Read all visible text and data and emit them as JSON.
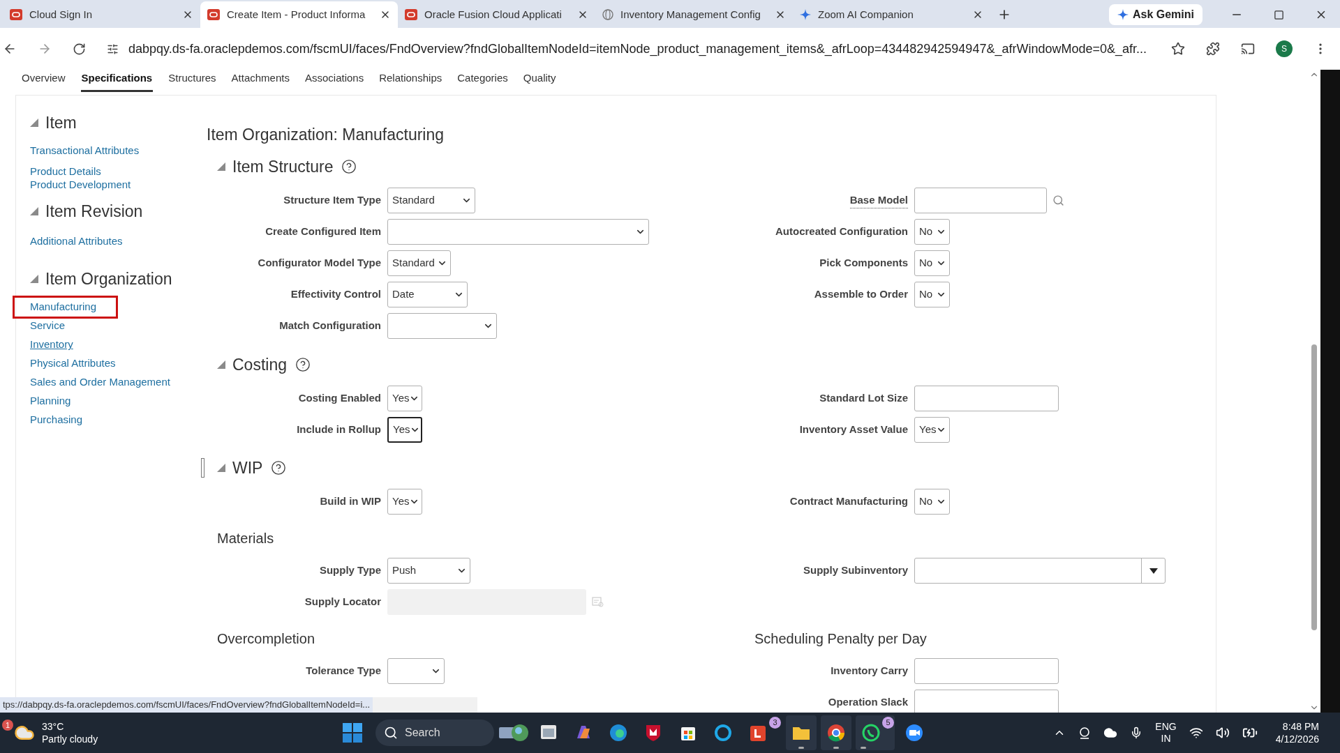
{
  "browser": {
    "tabs": [
      {
        "title": "Cloud Sign In",
        "selected": false
      },
      {
        "title": "Create Item - Product Informa",
        "selected": true
      },
      {
        "title": "Oracle Fusion Cloud Applicati",
        "selected": false
      },
      {
        "title": "Inventory Management Config",
        "selected": false
      },
      {
        "title": "Zoom AI Companion",
        "selected": false
      }
    ],
    "gemini_button": "Ask Gemini",
    "url": "dabpqy.ds-fa.oraclepdemos.com/fscmUI/faces/FndOverview?fndGlobalItemNodeId=itemNode_product_management_items&_afrLoop=434482942594947&_afrWindowMode=0&_afr...",
    "avatar": "S"
  },
  "page_tabs": [
    {
      "label": "Overview",
      "selected": false
    },
    {
      "label": "Specifications",
      "selected": true
    },
    {
      "label": "Structures",
      "selected": false
    },
    {
      "label": "Attachments",
      "selected": false
    },
    {
      "label": "Associations",
      "selected": false
    },
    {
      "label": "Relationships",
      "selected": false
    },
    {
      "label": "Categories",
      "selected": false
    },
    {
      "label": "Quality",
      "selected": false
    }
  ],
  "sidebar": {
    "groups": [
      {
        "title": "Item",
        "links": [
          {
            "label": "Transactional Attributes",
            "selected": false,
            "hovered": false
          },
          {
            "label": "Product Details",
            "selected": false,
            "hovered": false
          },
          {
            "label": "Product Development",
            "selected": false,
            "hovered": false
          }
        ]
      },
      {
        "title": "Item Revision",
        "links": [
          {
            "label": "Additional Attributes",
            "selected": false,
            "hovered": false
          }
        ]
      },
      {
        "title": "Item Organization",
        "links": [
          {
            "label": "Manufacturing",
            "selected": true,
            "hovered": false
          },
          {
            "label": "Service",
            "selected": false,
            "hovered": false
          },
          {
            "label": "Inventory",
            "selected": false,
            "hovered": true
          },
          {
            "label": "Physical Attributes",
            "selected": false,
            "hovered": false
          },
          {
            "label": "Sales and Order Management",
            "selected": false,
            "hovered": false
          },
          {
            "label": "Planning",
            "selected": false,
            "hovered": false
          },
          {
            "label": "Purchasing",
            "selected": false,
            "hovered": false
          }
        ]
      }
    ]
  },
  "main": {
    "title": "Item Organization: Manufacturing",
    "blocks": [
      {
        "kind": "section",
        "title": "Item Structure"
      },
      {
        "kind": "row",
        "left": {
          "label": "Structure Item Type",
          "kind": "select",
          "value": "Standard",
          "focused": false
        },
        "right": {
          "label": "Base Model",
          "kind": "lookup",
          "focused": false
        }
      },
      {
        "kind": "row",
        "left": {
          "label": "Create Configured Item",
          "kind": "select",
          "focused": false
        },
        "right": {
          "label": "Autocreated Configuration",
          "kind": "select",
          "value": "No",
          "focused": false
        }
      },
      {
        "kind": "row",
        "left": {
          "label": "Configurator Model Type",
          "kind": "select",
          "value": "Standard",
          "focused": false
        },
        "right": {
          "label": "Pick Components",
          "kind": "select",
          "value": "No",
          "focused": false
        }
      },
      {
        "kind": "row",
        "left": {
          "label": "Effectivity Control",
          "kind": "select",
          "value": "Date",
          "focused": false
        },
        "right": {
          "label": "Assemble to Order",
          "kind": "select",
          "value": "No",
          "focused": false
        }
      },
      {
        "kind": "row",
        "left": {
          "label": "Match Configuration",
          "kind": "select",
          "focused": false
        }
      },
      {
        "kind": "section",
        "title": "Costing"
      },
      {
        "kind": "row",
        "left": {
          "label": "Costing Enabled",
          "kind": "select",
          "value": "Yes",
          "focused": false
        },
        "right": {
          "label": "Standard Lot Size",
          "kind": "text",
          "focused": false
        }
      },
      {
        "kind": "row",
        "left": {
          "label": "Include in Rollup",
          "kind": "select",
          "value": "Yes",
          "focused": true
        },
        "right": {
          "label": "Inventory Asset Value",
          "kind": "select",
          "value": "Yes",
          "focused": false
        }
      },
      {
        "kind": "section",
        "title": "WIP"
      },
      {
        "kind": "row",
        "left": {
          "label": "Build in WIP",
          "kind": "select",
          "value": "Yes",
          "focused": false
        },
        "right": {
          "label": "Contract Manufacturing",
          "kind": "select",
          "value": "No",
          "focused": false
        }
      },
      {
        "kind": "subheading",
        "left": "Materials"
      },
      {
        "kind": "row",
        "left": {
          "label": "Supply Type",
          "kind": "select",
          "value": "Push",
          "focused": false
        },
        "right": {
          "label": "Supply Subinventory",
          "kind": "combo",
          "focused": false
        }
      },
      {
        "kind": "row",
        "left": {
          "label": "Supply Locator",
          "kind": "readonly",
          "focused": false
        }
      },
      {
        "kind": "subheading",
        "left": "Overcompletion",
        "right": "Scheduling Penalty per Day"
      },
      {
        "kind": "row",
        "left": {
          "label": "Tolerance Type",
          "kind": "select",
          "focused": false
        },
        "right": {
          "label": "Inventory Carry",
          "kind": "text",
          "focused": false
        }
      },
      {
        "kind": "row",
        "right": {
          "label": "Operation Slack",
          "kind": "text",
          "focused": false
        }
      }
    ]
  },
  "status_url": "tps://dabpqy.ds-fa.oraclepdemos.com/fscmUI/faces/FndOverview?fndGlobalItemNodeId=i...",
  "taskbar": {
    "weather": {
      "temperature": "33°C",
      "condition": "Partly cloudy",
      "badge": "1"
    },
    "search": "Search",
    "apps": [
      {
        "kind": "image",
        "running": false
      },
      {
        "kind": "window",
        "running": false
      },
      {
        "kind": "copilot",
        "running": false
      },
      {
        "kind": "edge",
        "running": false
      },
      {
        "kind": "shield",
        "running": false
      },
      {
        "kind": "store",
        "running": false
      },
      {
        "kind": "ring",
        "running": false
      },
      {
        "kind": "office",
        "badge": "3",
        "running": false
      },
      {
        "kind": "folder",
        "running": true
      },
      {
        "kind": "chrome",
        "running": true
      },
      {
        "kind": "whatsapp",
        "badge": "5",
        "running": true
      },
      {
        "kind": "zoom",
        "running": false
      }
    ],
    "language": "ENG",
    "region": "IN",
    "time": "8:48 PM",
    "date": "4/12/2026"
  }
}
